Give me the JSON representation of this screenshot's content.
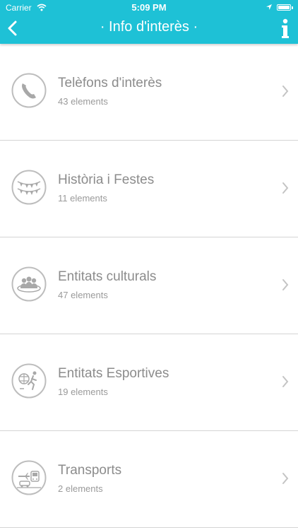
{
  "status_bar": {
    "carrier": "Carrier",
    "time": "5:09 PM"
  },
  "nav": {
    "title": "· Info d'interès ·"
  },
  "items": [
    {
      "title": "Telèfons d'interès",
      "subtitle": "43 elements",
      "icon": "phone-icon"
    },
    {
      "title": "Història i Festes",
      "subtitle": "11 elements",
      "icon": "bunting-icon"
    },
    {
      "title": "Entitats culturals",
      "subtitle": "47 elements",
      "icon": "group-icon"
    },
    {
      "title": "Entitats Esportives",
      "subtitle": "19 elements",
      "icon": "sports-icon"
    },
    {
      "title": "Transports",
      "subtitle": "2 elements",
      "icon": "transport-icon"
    }
  ],
  "colors": {
    "accent": "#1ec1d6",
    "text": "#8c8c8c",
    "divider": "#d4d4d4"
  }
}
